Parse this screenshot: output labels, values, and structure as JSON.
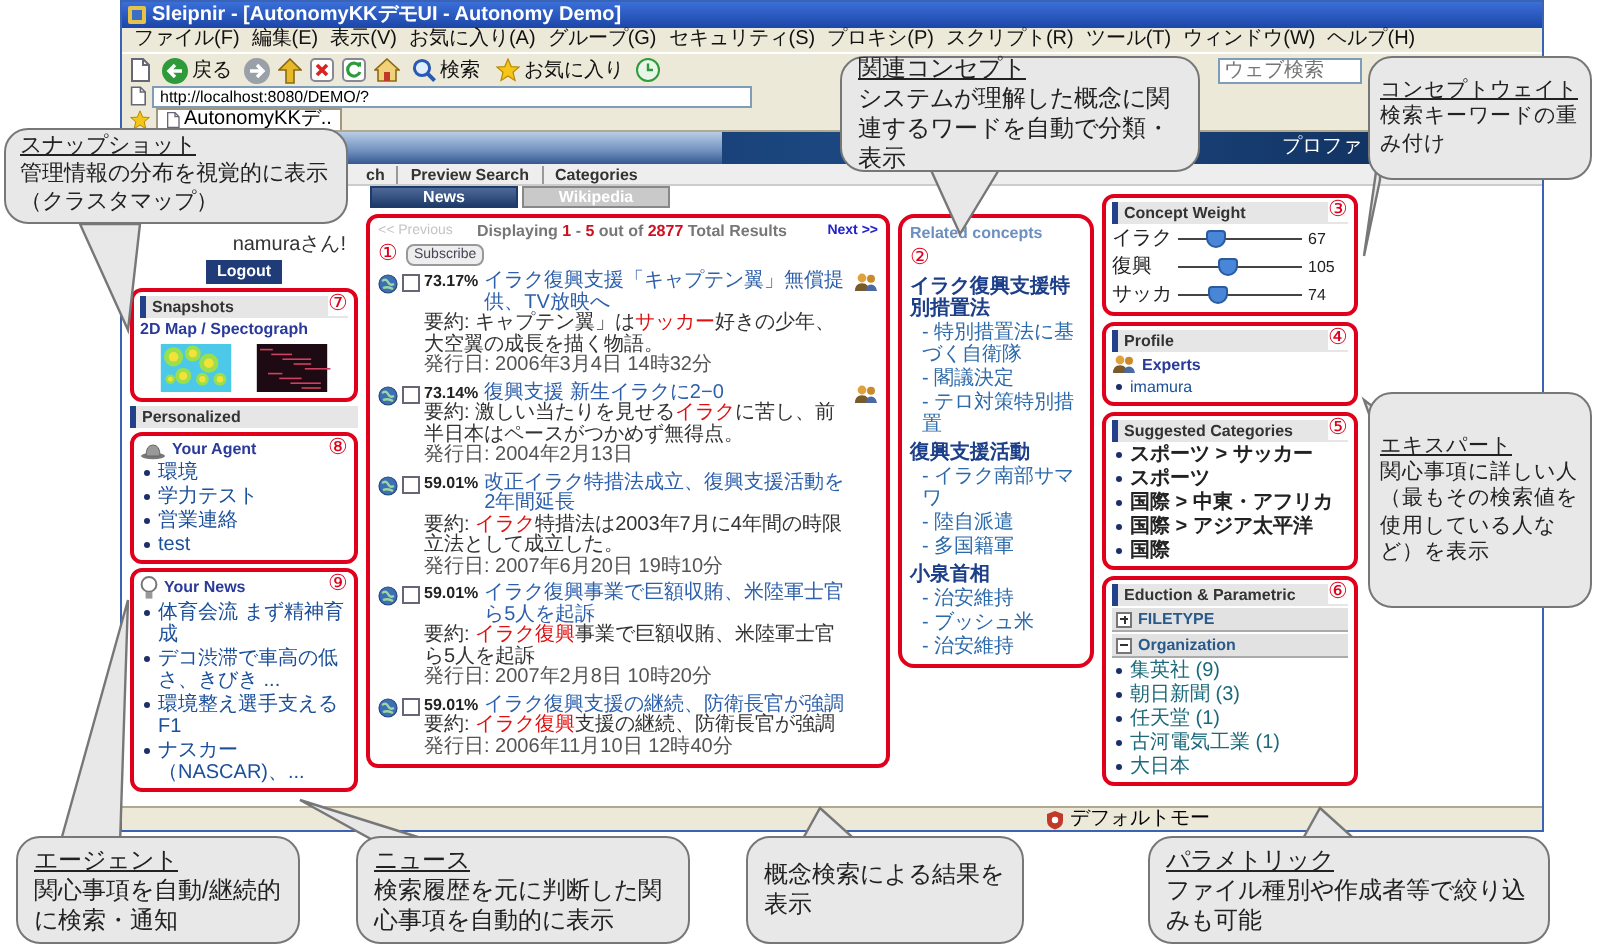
{
  "window": {
    "title": "Sleipnir - [AutonomyKKデモUI - Autonomy Demo]"
  },
  "menu": [
    "ファイル(F)",
    "編集(E)",
    "表示(V)",
    "お気に入り(A)",
    "グループ(G)",
    "セキュリティ(S)",
    "プロキシ(P)",
    "スクリプト(R)",
    "ツール(T)",
    "ウィンドウ(W)",
    "ヘルプ(H)"
  ],
  "toolbar": [
    {
      "kind": "back",
      "label": "戻る"
    },
    {
      "kind": "search",
      "label": "検索"
    },
    {
      "kind": "favorites",
      "label": "お気に入り"
    }
  ],
  "web_search": {
    "placeholder": "ウェブ検索"
  },
  "address": "http://localhost:8080/DEMO/?",
  "browser_tabs": [
    {
      "label": "AutonomyKKデ..",
      "selected": true
    }
  ],
  "banner": {
    "link": "プロファ"
  },
  "nav": [
    "ch",
    "Preview Search",
    "Categories"
  ],
  "sidebar": {
    "greeting": "namuraさん!",
    "logout": "Logout",
    "snapshots": {
      "header": "Snapshots",
      "badge": "⑦",
      "link": "2D Map / Spectograph"
    },
    "personalized": "Personalized",
    "agent": {
      "title": "Your Agent",
      "badge": "⑧",
      "items": [
        "環境",
        "学力テスト",
        "営業連絡",
        "test"
      ]
    },
    "news": {
      "title": "Your News",
      "badge": "⑨",
      "items": [
        "体育会流 まず精神育成",
        "デコ渋滞で車高の低さ、きびき ...",
        "環境整え選手支える F1",
        "ナスカー（NASCAR)、..."
      ]
    }
  },
  "results": {
    "tabs": [
      {
        "label": "News",
        "selected": true
      },
      {
        "label": "Wikipedia",
        "selected": false
      }
    ],
    "previous": {
      "label": "<< Previous",
      "disabled": true
    },
    "summary": "Displaying **1** - **5** out of **2877** Total Results",
    "next": "Next >>",
    "badge": "①",
    "subscribe": "Subscribe",
    "items": [
      {
        "score": "73.17%",
        "title": "イラク復興支援「キャプテン翼」無償提供、TV放映へ",
        "summary": "要約: キャプテン翼」は**サッカー**好きの少年、大空翼の成長を描く物語。",
        "date": "発行日: 2006年3月4日 14時32分",
        "checked": false,
        "expert": true
      },
      {
        "score": "73.14%",
        "title": "復興支援 新生イラクに2−0",
        "summary": "要約: 激しい当たりを見せる**イラク**に苦し、前半日本はペースがつかめず無得点。",
        "date": "発行日: 2004年2月13日",
        "checked": false,
        "expert": true
      },
      {
        "score": "59.01%",
        "title": "改正イラク特措法成立、復興支援活動を2年間延長",
        "summary": "要約: **イラク**特措法は2003年7月に4年間の時限立法として成立した。",
        "date": "発行日: 2007年6月20日 19時10分",
        "checked": false,
        "expert": false
      },
      {
        "score": "59.01%",
        "title": "イラク復興事業で巨額収賄、米陸軍士官ら5人を起訴",
        "summary": "要約: **イラク復興**事業で巨額収賄、米陸軍士官ら5人を起訴",
        "date": "発行日: 2007年2月8日 10時20分",
        "checked": false,
        "expert": false
      },
      {
        "score": "59.01%",
        "title": "イラク復興支援の継続、防衛長官が強調",
        "summary": "要約: **イラク復興**支援の継続、防衛長官が強調",
        "date": "発行日: 2006年11月10日 12時40分",
        "checked": false,
        "expert": false
      }
    ]
  },
  "related": {
    "title": "Related concepts",
    "badge": "②",
    "groups": [
      {
        "label": "イラク復興支援特別措置法",
        "children": [
          {
            "label": "- 特別措置法に基づく自衛隊"
          },
          {
            "label": "- 閣議決定"
          },
          {
            "label": "- テロ対策特別措置"
          }
        ]
      },
      {
        "label": "復興支援活動",
        "children": [
          {
            "label": "- イラク南部サマワ"
          },
          {
            "label": "- 陸自派遣"
          },
          {
            "label": "- 多国籍軍"
          }
        ]
      },
      {
        "label": "小泉首相",
        "children": [
          {
            "label": "- 治安維持"
          },
          {
            "label": "- ブッシュ米"
          },
          {
            "label": "- 治安維持"
          }
        ]
      }
    ]
  },
  "concept_weight": {
    "title": "Concept Weight",
    "badge": "③",
    "sliders": [
      {
        "label": "イラク",
        "level": 0.3,
        "reading": "67"
      },
      {
        "label": "復興",
        "level": 0.4,
        "reading": "105"
      },
      {
        "label": "サッカ",
        "level": 0.32,
        "reading": "74"
      }
    ]
  },
  "profile": {
    "title": "Profile",
    "badge": "④",
    "link": "Experts",
    "people": [
      "imamura"
    ]
  },
  "categories": {
    "title": "Suggested Categories",
    "badge": "⑤",
    "items": [
      "スポーツ > サッカー",
      "スポーツ",
      "国際 > 中東・アフリカ",
      "国際 > アジア太平洋",
      "国際"
    ]
  },
  "parametric": {
    "title": "Eduction & Parametric",
    "badge": "⑥",
    "facets": [
      {
        "label": "FILETYPE",
        "expanded": false
      },
      {
        "label": "Organization",
        "expanded": true,
        "items": [
          "集英社 (9)",
          "朝日新聞 (3)",
          "任天堂 (1)",
          "古河電気工業 (1)",
          "大日本"
        ]
      }
    ]
  },
  "status_bar": {
    "text": "デフォルトモー"
  },
  "callouts": [
    {
      "title": "スナップショット",
      "text": "管理情報の分布を視覚的に表示（クラスタマップ）"
    },
    {
      "title": "関連コンセプト",
      "text": "システムが理解した概念に関連するワードを自動で分類・表示"
    },
    {
      "title": "コンセプトウェイト",
      "text": "検索キーワードの重み付け"
    },
    {
      "title": "エキスパート",
      "text": "関心事項に詳しい人（最もその検索値を使用している人など）を表示"
    },
    {
      "title": "エージェント",
      "text": "関心事項を自動/継続的に検索・通知"
    },
    {
      "title": "ニュース",
      "text": "検索履歴を元に判断した関心事項を自動的に表示"
    },
    {
      "text": "概念検索による結果を表示"
    },
    {
      "title": "パラメトリック",
      "text": "ファイル種別や作成者等で絞り込みも可能"
    }
  ]
}
